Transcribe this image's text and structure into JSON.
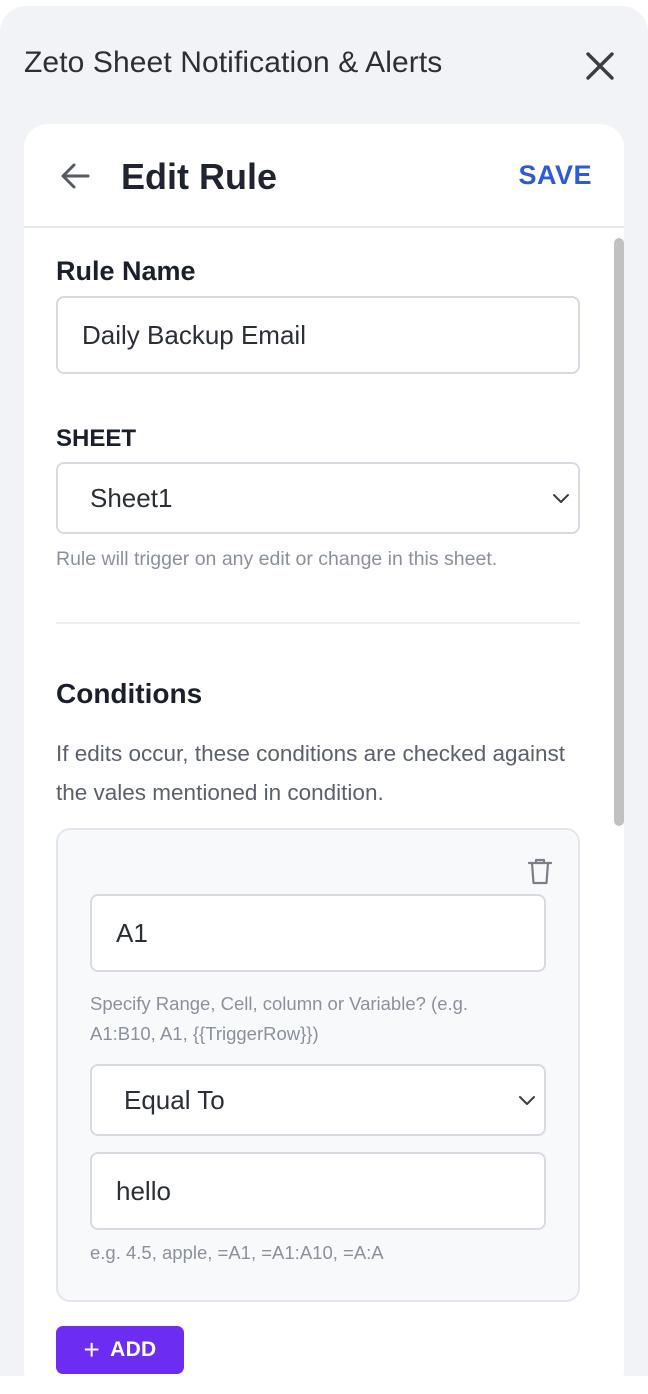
{
  "panel": {
    "title": "Zeto Sheet Notification & Alerts"
  },
  "header": {
    "title": "Edit Rule",
    "save_label": "SAVE"
  },
  "rule_name": {
    "label": "Rule Name",
    "value": "Daily Backup Email"
  },
  "sheet": {
    "label": "SHEET",
    "selected": "Sheet1",
    "help": "Rule will trigger on any edit or change in this sheet."
  },
  "conditions": {
    "title": "Conditions",
    "description": "If edits occur, these conditions are checked against the vales mentioned in condition.",
    "items": [
      {
        "range_value": "A1",
        "range_help": "Specify Range, Cell, column or Variable? (e.g. A1:B10, A1, {{TriggerRow}})",
        "operator": "Equal To",
        "compare_value": "hello",
        "compare_help": "e.g. 4.5, apple, =A1, =A1:A10, =A:A"
      }
    ],
    "add_label": "ADD"
  },
  "colors": {
    "accent_blue": "#2f5bd8",
    "add_purple": "#6d2cf2"
  },
  "icons": [
    "close-icon",
    "back-arrow-icon",
    "chevron-down-icon",
    "trash-icon",
    "plus-icon"
  ]
}
